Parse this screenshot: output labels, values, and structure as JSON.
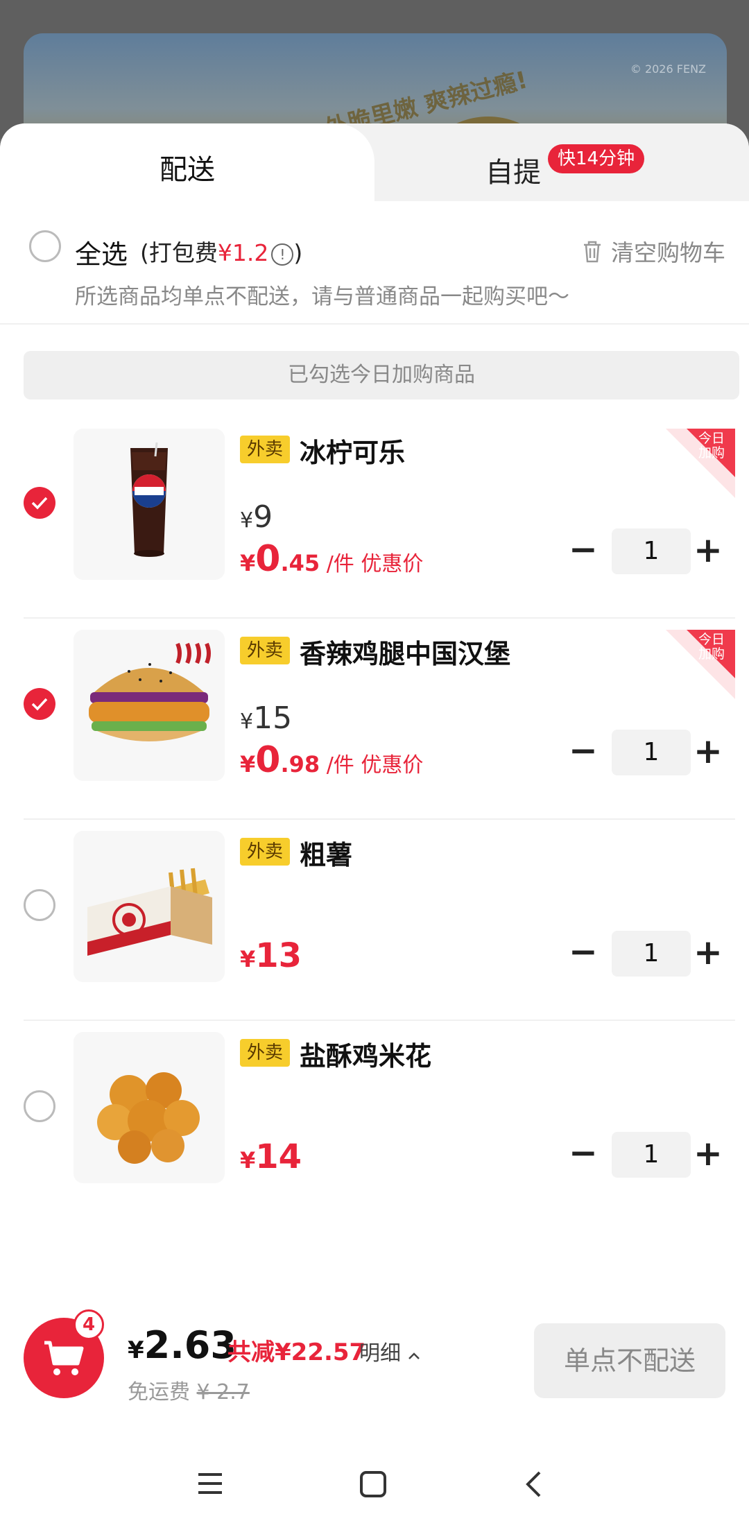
{
  "background": {
    "banner_slogan": "外脆里嫩 爽辣过瘾!",
    "banner_copyright": "© 2026 FENZ"
  },
  "tabs": {
    "delivery": "配送",
    "pickup": "自提",
    "pickup_badge": "快14分钟"
  },
  "select_all": {
    "label": "全选",
    "pack_fee_prefix": "(打包费",
    "pack_fee_value": "¥1.2",
    "pack_fee_suffix": ")",
    "clear_cart": "清空购物车",
    "notice": "所选商品均单点不配送，请与普通商品一起购买吧～"
  },
  "today_banner": "已勾选今日加购商品",
  "items": [
    {
      "tag": "外卖",
      "name": "冰柠可乐",
      "checked": true,
      "orig_yen": "¥",
      "orig_price": "9",
      "promo_yen": "¥",
      "promo_int": "0",
      "promo_dec": ".45",
      "promo_unit": "/件 优惠价",
      "corner": "今日加购",
      "qty": "1"
    },
    {
      "tag": "外卖",
      "name": "香辣鸡腿中国汉堡",
      "checked": true,
      "orig_yen": "¥",
      "orig_price": "15",
      "promo_yen": "¥",
      "promo_int": "0",
      "promo_dec": ".98",
      "promo_unit": "/件 优惠价",
      "corner": "今日加购",
      "qty": "1"
    },
    {
      "tag": "外卖",
      "name": "粗薯",
      "checked": false,
      "sale_yen": "¥",
      "sale_price": "13",
      "qty": "1"
    },
    {
      "tag": "外卖",
      "name": "盐酥鸡米花",
      "checked": false,
      "sale_yen": "¥",
      "sale_price": "14",
      "qty": "1"
    }
  ],
  "stepper": {
    "minus": "−",
    "plus": "+"
  },
  "bottom": {
    "cart_count": "4",
    "total_yen": "¥",
    "total": "2.63",
    "saved": "共减¥22.57",
    "detail": "明细",
    "delivery_label": "免运费",
    "delivery_orig": "¥ 2.7",
    "no_delivery_button": "单点不配送"
  },
  "colors": {
    "accent": "#e8243a",
    "tag_yellow": "#f7cd2c"
  },
  "icons": [
    "trash-icon",
    "info-icon",
    "check-icon",
    "cart-icon",
    "chevron-up-icon",
    "menu-icon",
    "home-icon",
    "back-icon"
  ]
}
